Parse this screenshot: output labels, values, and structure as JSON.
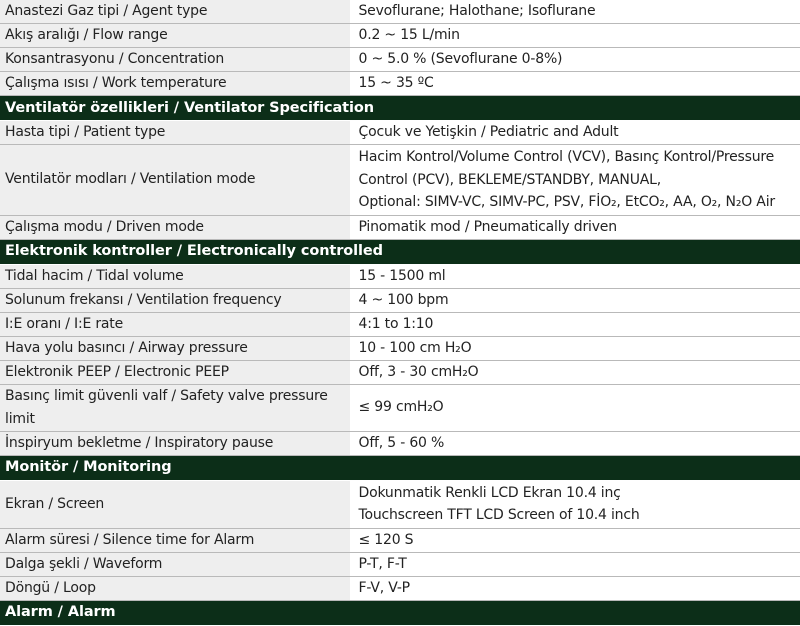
{
  "rows": [
    {
      "type": "row",
      "label": "Anastezi Gaz tipi / Agent type",
      "value": "Sevoflurane; Halothane; Isoflurane"
    },
    {
      "type": "row",
      "label": "Akış aralığı / Flow range",
      "value": "0.2 ~ 15 L/min"
    },
    {
      "type": "row",
      "label": "Konsantrasyonu / Concentration",
      "value": "0 ~ 5.0 % (Sevoflurane 0-8%)"
    },
    {
      "type": "row",
      "label": "Çalışma ısısı / Work temperature",
      "value": "15 ~ 35 ºC"
    },
    {
      "type": "section",
      "label": "Ventilatör özellikleri / Ventilator Specification"
    },
    {
      "type": "row",
      "label": "Hasta tipi / Patient type",
      "value": "Çocuk ve Yetişkin / Pediatric and Adult"
    },
    {
      "type": "multi",
      "label": "Ventilatör modları / Ventilation mode",
      "lines": [
        "Hacim Kontrol/Volume Control (VCV), Basınç Kontrol/Pressure",
        "Control (PCV), BEKLEME/STANDBY, MANUAL,",
        "Optional: SIMV-VC, SIMV-PC, PSV, FİO₂, EtCO₂, AA, O₂, N₂O Air"
      ]
    },
    {
      "type": "row",
      "label": "Çalışma modu / Driven mode",
      "value": "Pinomatik mod / Pneumatically driven"
    },
    {
      "type": "section",
      "label": "Elektronik kontroller / Electronically controlled"
    },
    {
      "type": "row",
      "label": "Tidal hacim / Tidal volume",
      "value": "15 - 1500 ml"
    },
    {
      "type": "row",
      "label": "Solunum frekansı / Ventilation frequency",
      "value": "4 ~ 100 bpm"
    },
    {
      "type": "row",
      "label": "I:E  oranı / I:E rate",
      "value": "4:1 to 1:10"
    },
    {
      "type": "row",
      "label": "Hava yolu basıncı / Airway pressure",
      "value": "10 - 100 cm H₂O"
    },
    {
      "type": "row",
      "label": "Elektronik PEEP / Electronic PEEP",
      "value": "Off, 3 - 30 cmH₂O"
    },
    {
      "type": "row",
      "label": "Basınç limit güvenli valf / Safety valve pressure limit",
      "value": "≤ 99 cmH₂O"
    },
    {
      "type": "row",
      "label": "İnspiryum bekletme / Inspiratory pause",
      "value": "Off, 5 - 60 %"
    },
    {
      "type": "section",
      "label": "Monitör / Monitoring"
    },
    {
      "type": "multi",
      "label": "Ekran / Screen",
      "lines": [
        "Dokunmatik Renkli LCD Ekran 10.4 inç",
        "Touchscreen TFT LCD Screen of 10.4 inch"
      ]
    },
    {
      "type": "row",
      "label": "Alarm süresi / Silence time for Alarm",
      "value": "≤ 120 S"
    },
    {
      "type": "row",
      "label": "Dalga şekli / Waveform",
      "value": "P-T, F-T"
    },
    {
      "type": "row",
      "label": "Döngü / Loop",
      "value": "F-V, V-P"
    },
    {
      "type": "section",
      "label": "Alarm / Alarm"
    }
  ],
  "colors": {
    "section_bg": "#0c2e18",
    "label_bg": "#eeeeee"
  }
}
